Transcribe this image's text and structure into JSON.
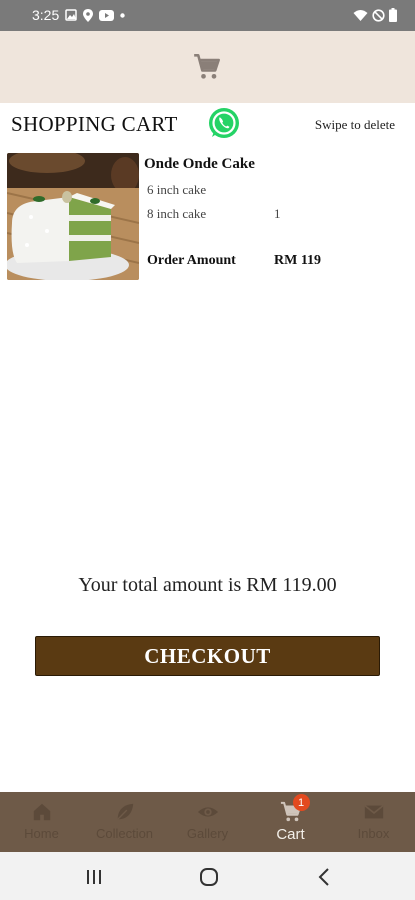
{
  "status_bar": {
    "time": "3:25",
    "icons_left": [
      "image-icon",
      "location-icon",
      "youtube-icon",
      "dot-icon"
    ],
    "icons_right": [
      "wifi-icon",
      "do-not-disturb-icon",
      "battery-icon"
    ]
  },
  "header": {
    "icon": "cart-icon"
  },
  "title": "SHOPPING CART",
  "swipe_hint": "Swipe to delete",
  "cart_item": {
    "name": "Onde Onde Cake",
    "option_1": "6 inch cake",
    "option_2": "8 inch cake",
    "option_2_qty": "1",
    "order_amount_label": "Order Amount",
    "order_amount_value": "RM 119"
  },
  "total_text": "Your total amount is RM 119.00",
  "checkout_label": "CHECKOUT",
  "bottom_nav": [
    {
      "label": "Home",
      "icon": "home-icon",
      "active": false
    },
    {
      "label": "Collection",
      "icon": "leaf-icon",
      "active": false
    },
    {
      "label": "Gallery",
      "icon": "eye-icon",
      "active": false
    },
    {
      "label": "Cart",
      "icon": "cart-icon",
      "active": true,
      "badge": "1"
    },
    {
      "label": "Inbox",
      "icon": "mail-icon",
      "active": false
    }
  ],
  "colors": {
    "header_bg": "#efe5dc",
    "checkout_bg": "#5a3a12",
    "nav_bg": "#6e5a48",
    "badge": "#e34a1f",
    "whatsapp": "#25d366"
  }
}
